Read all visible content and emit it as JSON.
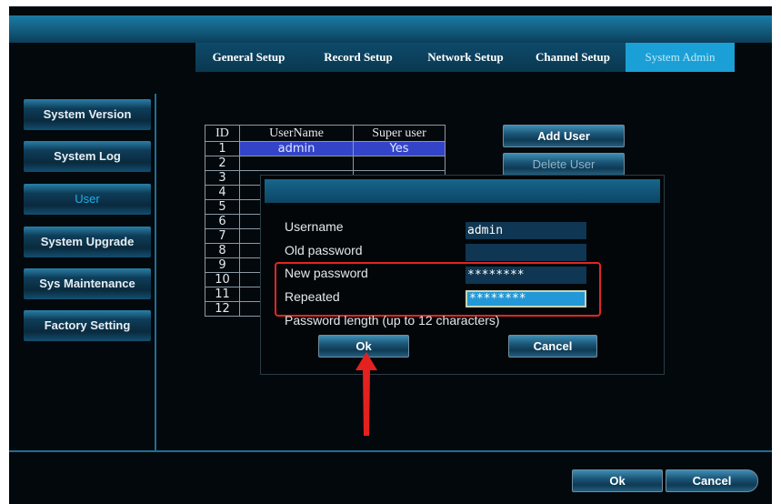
{
  "tabs": [
    "General Setup",
    "Record Setup",
    "Network Setup",
    "Channel Setup",
    "System Admin"
  ],
  "active_tab": "System Admin",
  "sidebar": [
    {
      "label": "System Version",
      "active": false
    },
    {
      "label": "System Log",
      "active": false
    },
    {
      "label": "User",
      "active": true
    },
    {
      "label": "System Upgrade",
      "active": false
    },
    {
      "label": "Sys Maintenance",
      "active": false
    },
    {
      "label": "Factory Setting",
      "active": false
    }
  ],
  "user_table": {
    "headers": [
      "ID",
      "UserName",
      "Super user"
    ],
    "rows": [
      {
        "id": "1",
        "name": "admin",
        "super": "Yes"
      },
      {
        "id": "2",
        "name": "",
        "super": ""
      },
      {
        "id": "3",
        "name": "",
        "super": ""
      },
      {
        "id": "4",
        "name": "",
        "super": ""
      },
      {
        "id": "5",
        "name": "",
        "super": ""
      },
      {
        "id": "6",
        "name": "",
        "super": ""
      },
      {
        "id": "7",
        "name": "",
        "super": ""
      },
      {
        "id": "8",
        "name": "",
        "super": ""
      },
      {
        "id": "9",
        "name": "",
        "super": ""
      },
      {
        "id": "10",
        "name": "",
        "super": ""
      },
      {
        "id": "11",
        "name": "",
        "super": ""
      },
      {
        "id": "12",
        "name": "",
        "super": ""
      }
    ]
  },
  "buttons": {
    "add_user": "Add User",
    "delete_user": "Delete User",
    "ok": "Ok",
    "cancel": "Cancel"
  },
  "dialog": {
    "username_label": "Username",
    "username_value": "admin",
    "old_password_label": "Old password",
    "old_password_value": "",
    "new_password_label": "New password",
    "new_password_value": "********",
    "repeated_label": "Repeated",
    "repeated_value": "********",
    "hint": "Password length (up to 12 characters)",
    "ok": "Ok",
    "cancel": "Cancel"
  },
  "colors": {
    "highlight_box": "#e22525",
    "accent": "#1aa0d6",
    "selected_row": "#3344c8"
  }
}
